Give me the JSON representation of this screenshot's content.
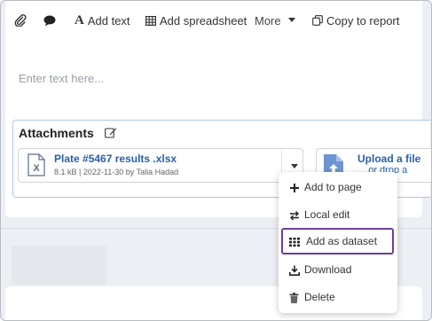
{
  "toolbar": {
    "items": [
      {
        "label": "",
        "icon": "paperclip-icon"
      },
      {
        "label": "",
        "icon": "comment-icon"
      },
      {
        "label": "Add text",
        "icon": "text-icon",
        "icon_text": "A"
      },
      {
        "label": "Add spreadsheet",
        "icon": "table-icon"
      },
      {
        "label": "More",
        "icon": "caret-down-icon"
      },
      {
        "label": "Copy to report",
        "icon": "copy-icon"
      }
    ]
  },
  "editor": {
    "placeholder": "Enter text here..."
  },
  "attachments": {
    "title": "Attachments",
    "file": {
      "name": "Plate #5467 results .xlsx",
      "meta": "8.1 kB | 2022-11-30 by Talia Hadad",
      "icon_text": "X"
    },
    "upload": {
      "label": "Upload a file",
      "sub": "... or drop a"
    }
  },
  "context_menu": {
    "items": [
      {
        "label": "Add to page",
        "icon": "plus-icon"
      },
      {
        "label": "Local edit",
        "icon": "swap-icon"
      },
      {
        "label": "Add as dataset",
        "icon": "grid-icon",
        "highlighted": true
      },
      {
        "label": "Download",
        "icon": "download-icon"
      },
      {
        "label": "Delete",
        "icon": "trash-icon"
      }
    ]
  },
  "colors": {
    "link": "#2a5fa8",
    "highlight_border": "#6b3fa0",
    "attachments_border": "#a9c8f0"
  }
}
